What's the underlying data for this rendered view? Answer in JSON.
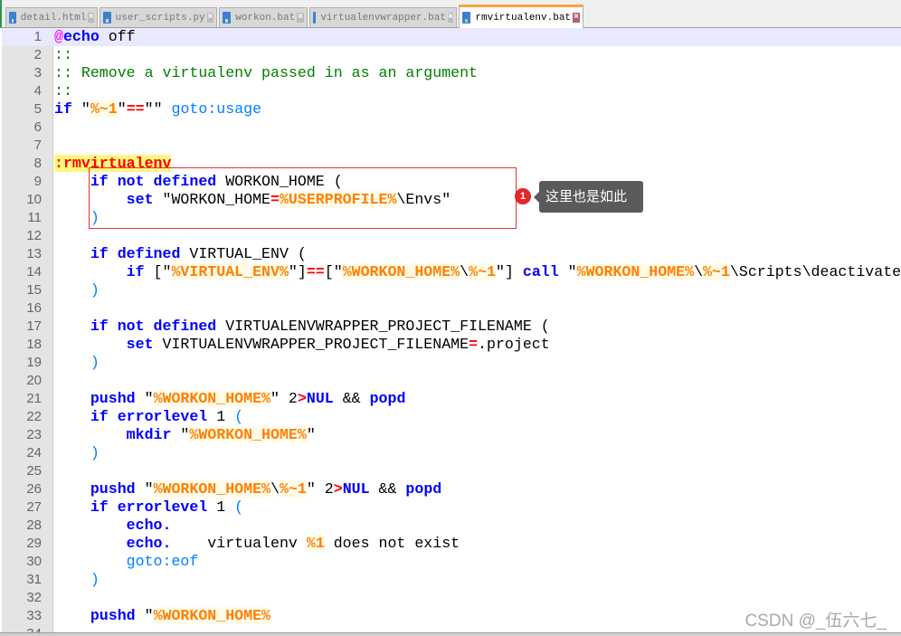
{
  "tabs": [
    {
      "label": "detail.html"
    },
    {
      "label": "user_scripts.py"
    },
    {
      "label": "workon.bat"
    },
    {
      "label": "virtualenvwrapper.bat"
    },
    {
      "label": "rmvirtualenv.bat",
      "active": true
    }
  ],
  "lines": [
    [
      [
        "at",
        "@"
      ],
      [
        "kw",
        "echo"
      ],
      [
        "txt",
        " off"
      ]
    ],
    [
      [
        "cmt",
        "::"
      ]
    ],
    [
      [
        "cmt",
        ":: Remove a virtualenv passed in as an argument"
      ]
    ],
    [
      [
        "cmt",
        "::"
      ]
    ],
    [
      [
        "kw",
        "if"
      ],
      [
        "txt",
        " \""
      ],
      [
        "var",
        "%~1"
      ],
      [
        "txt",
        "\""
      ],
      [
        "op",
        "=="
      ],
      [
        "txt",
        "\"\" "
      ],
      [
        "go",
        "goto:usage"
      ]
    ],
    [],
    [],
    [
      [
        "lbl",
        ":rmvirtualenv"
      ]
    ],
    [
      [
        "txt",
        "    "
      ],
      [
        "kw",
        "if not defined"
      ],
      [
        "txt",
        " WORKON_HOME ("
      ]
    ],
    [
      [
        "txt",
        "        "
      ],
      [
        "kw",
        "set"
      ],
      [
        "txt",
        " \"WORKON_HOME"
      ],
      [
        "op",
        "="
      ],
      [
        "var",
        "%USERPROFILE%"
      ],
      [
        "txt",
        "\\Envs\""
      ]
    ],
    [
      [
        "txt",
        "    "
      ],
      [
        "par",
        ")"
      ]
    ],
    [],
    [
      [
        "txt",
        "    "
      ],
      [
        "kw",
        "if defined"
      ],
      [
        "txt",
        " VIRTUAL_ENV ("
      ]
    ],
    [
      [
        "txt",
        "        "
      ],
      [
        "kw",
        "if"
      ],
      [
        "txt",
        " [\""
      ],
      [
        "var",
        "%VIRTUAL_ENV%"
      ],
      [
        "txt",
        "\"]"
      ],
      [
        "op",
        "=="
      ],
      [
        "txt",
        "[\""
      ],
      [
        "var",
        "%WORKON_HOME%"
      ],
      [
        "txt",
        "\\"
      ],
      [
        "var",
        "%~1"
      ],
      [
        "txt",
        "\"] "
      ],
      [
        "kw",
        "call"
      ],
      [
        "txt",
        " \""
      ],
      [
        "var",
        "%WORKON_HOME%"
      ],
      [
        "txt",
        "\\"
      ],
      [
        "var",
        "%~1"
      ],
      [
        "txt",
        "\\Scripts\\deactivate"
      ]
    ],
    [
      [
        "txt",
        "    "
      ],
      [
        "par",
        ")"
      ]
    ],
    [],
    [
      [
        "txt",
        "    "
      ],
      [
        "kw",
        "if not defined"
      ],
      [
        "txt",
        " VIRTUALENVWRAPPER_PROJECT_FILENAME ("
      ]
    ],
    [
      [
        "txt",
        "        "
      ],
      [
        "kw",
        "set"
      ],
      [
        "txt",
        " VIRTUALENVWRAPPER_PROJECT_FILENAME"
      ],
      [
        "op",
        "="
      ],
      [
        "txt",
        ".project"
      ]
    ],
    [
      [
        "txt",
        "    "
      ],
      [
        "par",
        ")"
      ]
    ],
    [],
    [
      [
        "txt",
        "    "
      ],
      [
        "kw",
        "pushd"
      ],
      [
        "txt",
        " \""
      ],
      [
        "var",
        "%WORKON_HOME%"
      ],
      [
        "txt",
        "\" 2"
      ],
      [
        "op",
        ">"
      ],
      [
        "kw",
        "NUL"
      ],
      [
        "txt",
        " && "
      ],
      [
        "kw",
        "popd"
      ]
    ],
    [
      [
        "txt",
        "    "
      ],
      [
        "kw",
        "if errorlevel"
      ],
      [
        "txt",
        " 1 "
      ],
      [
        "par",
        "("
      ]
    ],
    [
      [
        "txt",
        "        "
      ],
      [
        "kw",
        "mkdir"
      ],
      [
        "txt",
        " \""
      ],
      [
        "var",
        "%WORKON_HOME%"
      ],
      [
        "txt",
        "\""
      ]
    ],
    [
      [
        "txt",
        "    "
      ],
      [
        "par",
        ")"
      ]
    ],
    [],
    [
      [
        "txt",
        "    "
      ],
      [
        "kw",
        "pushd"
      ],
      [
        "txt",
        " \""
      ],
      [
        "var",
        "%WORKON_HOME%"
      ],
      [
        "txt",
        "\\"
      ],
      [
        "var",
        "%~1"
      ],
      [
        "txt",
        "\" 2"
      ],
      [
        "op",
        ">"
      ],
      [
        "kw",
        "NUL"
      ],
      [
        "txt",
        " && "
      ],
      [
        "kw",
        "popd"
      ]
    ],
    [
      [
        "txt",
        "    "
      ],
      [
        "kw",
        "if errorlevel"
      ],
      [
        "txt",
        " 1 "
      ],
      [
        "par",
        "("
      ]
    ],
    [
      [
        "txt",
        "        "
      ],
      [
        "kw",
        "echo."
      ]
    ],
    [
      [
        "txt",
        "        "
      ],
      [
        "kw",
        "echo."
      ],
      [
        "txt",
        "    virtualenv "
      ],
      [
        "var",
        "%1"
      ],
      [
        "txt",
        " does not exist"
      ]
    ],
    [
      [
        "txt",
        "        "
      ],
      [
        "go",
        "goto:eof"
      ]
    ],
    [
      [
        "txt",
        "    "
      ],
      [
        "par",
        ")"
      ]
    ],
    [],
    [
      [
        "txt",
        "    "
      ],
      [
        "kw",
        "pushd"
      ],
      [
        "txt",
        " \""
      ],
      [
        "var",
        "%WORKON_HOME%"
      ]
    ],
    []
  ],
  "annotation": {
    "badge": "1",
    "tooltip": "这里也是如此"
  },
  "watermark": "CSDN @_伍六七_"
}
